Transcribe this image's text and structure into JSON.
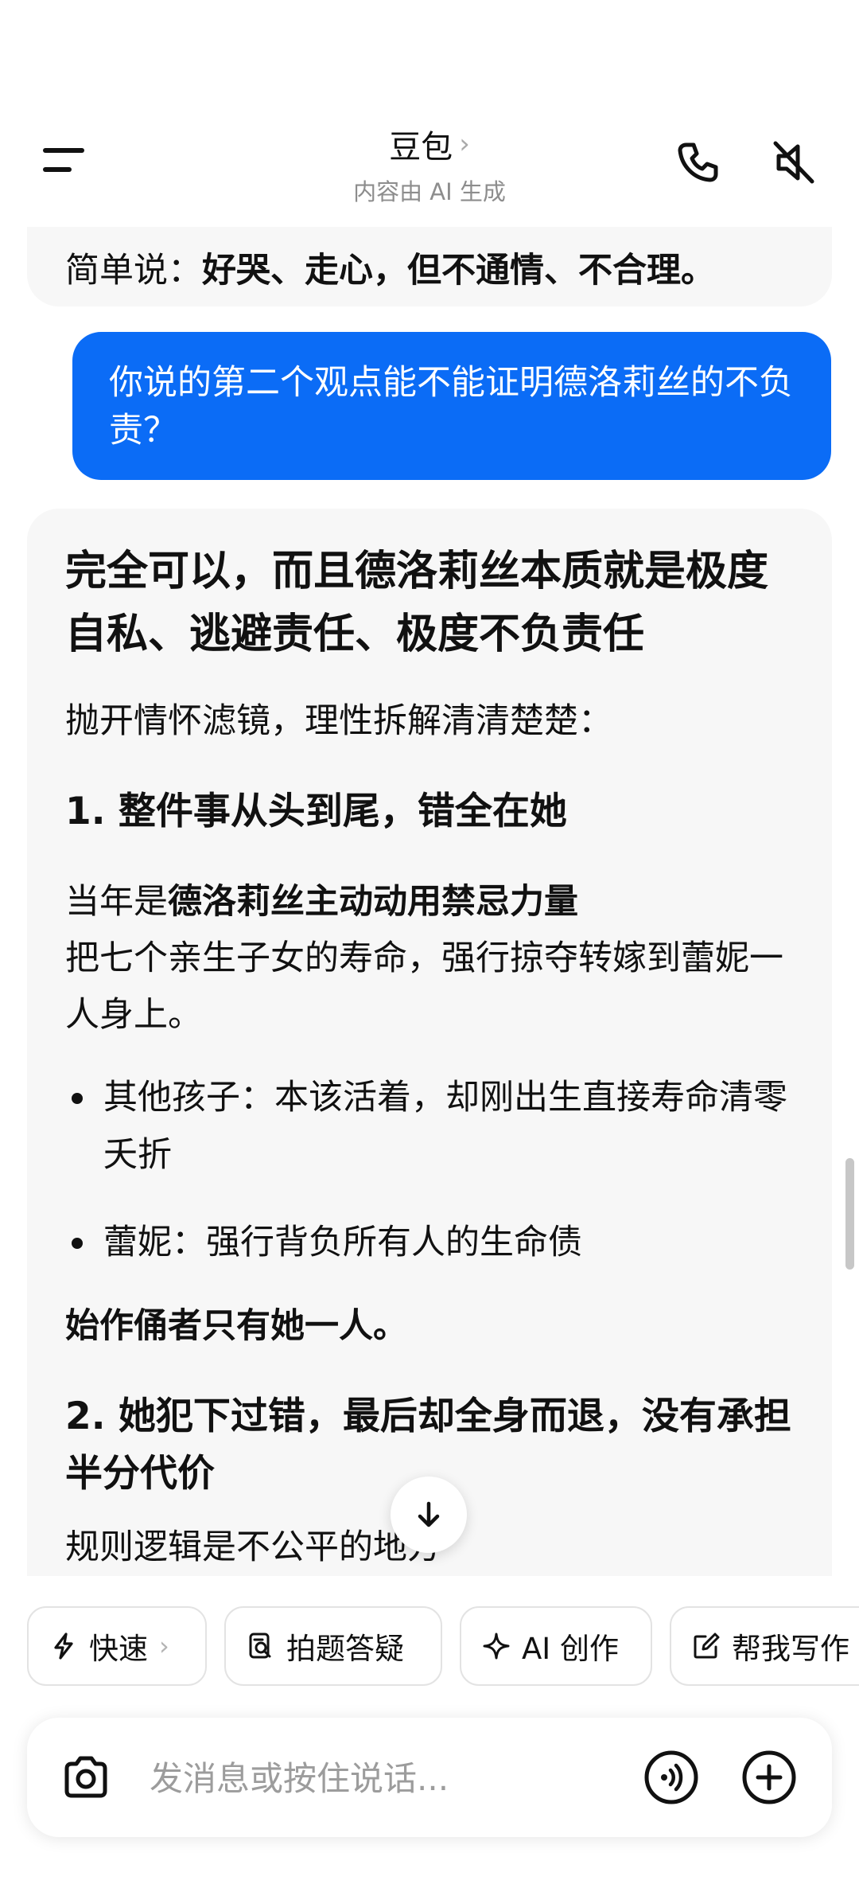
{
  "header": {
    "title": "豆包",
    "title_chevron": "›",
    "subtitle": "内容由 AI 生成"
  },
  "messages": {
    "previous_ai_tail": {
      "prefix": "简单说：",
      "bold": "好哭、走心，但不通情、不合理。"
    },
    "user": {
      "text": "你说的第二个观点能不能证明德洛莉丝的不负责？"
    },
    "ai": {
      "heading": "完全可以，而且德洛莉丝本质就是极度自私、逃避责任、极度不负责任",
      "intro": "抛开情怀滤镜，理性拆解清清楚楚：",
      "section1_title": "1. 整件事从头到尾，错全在她",
      "section1_p_prefix": "当年是",
      "section1_p_bold": "德洛莉丝主动动用禁忌力量",
      "section1_p_rest": "把七个亲生子女的寿命，强行掠夺转嫁到蕾妮一人身上。",
      "bullets": [
        "其他孩子：本该活着，却刚出生直接寿命清零夭折",
        "蕾妮：强行背负所有人的生命债"
      ],
      "bold_line": "始作俑者只有她一人。",
      "section2_title": "2. 她犯下过错，最后却全身而退，没有承担半分代价",
      "cut_text": "规则逻辑是不公平的地方"
    }
  },
  "chips": [
    {
      "label": "快速",
      "icon": "lightning-icon",
      "chevron": "›"
    },
    {
      "label": "拍题答疑",
      "icon": "photo-search-icon"
    },
    {
      "label": "AI 创作",
      "icon": "sparkle-icon"
    },
    {
      "label": "帮我写作",
      "icon": "edit-icon"
    }
  ],
  "input": {
    "placeholder": "发消息或按住说话..."
  },
  "colors": {
    "accent": "#0b6cf6",
    "bubble_bg": "#f7f7f7",
    "muted_text": "#8d8d8d"
  }
}
